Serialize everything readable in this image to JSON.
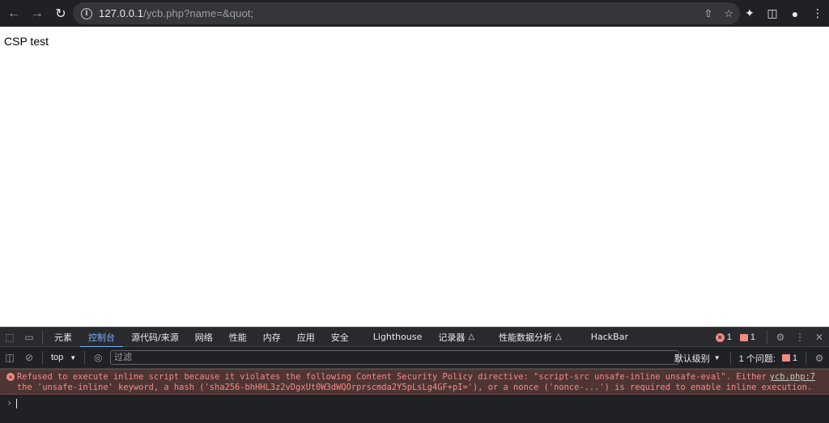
{
  "browser": {
    "url_host": "127.0.0.1",
    "url_path": "/ycb.php?name=&quot;"
  },
  "page": {
    "body_text": "CSP test"
  },
  "devtools": {
    "tabs": [
      {
        "label": "元素"
      },
      {
        "label": "控制台",
        "active": true
      },
      {
        "label": "源代码/来源"
      },
      {
        "label": "网络"
      },
      {
        "label": "性能"
      },
      {
        "label": "内存"
      },
      {
        "label": "应用"
      },
      {
        "label": "安全"
      },
      {
        "label": "Lighthouse"
      },
      {
        "label": "记录器"
      },
      {
        "label": "性能数据分析"
      },
      {
        "label": "HackBar"
      }
    ],
    "error_count": "1",
    "issue_count": "1",
    "context": "top",
    "filter_placeholder": "过滤",
    "log_level": "默认级别",
    "issues_label": "1 个问题:",
    "issues_count": "1",
    "log_line1": "Refused to execute inline script because it violates the following Content Security Policy directive: \"script-src unsafe-inline unsafe-eval\". Either",
    "log_line2": "the 'unsafe-inline' keyword, a hash ('sha256-bhHHL3z2vDgxUt0W3dWQOrprscmda2Y5pLsLg4GF+pI='), or a nonce ('nonce-...') is required to enable inline execution.",
    "log_source": "ycb.php:7"
  },
  "colors": {
    "chrome_bg": "#202124",
    "accent": "#7cacf8",
    "error": "#f28b82",
    "error_bg": "#4e3534"
  }
}
